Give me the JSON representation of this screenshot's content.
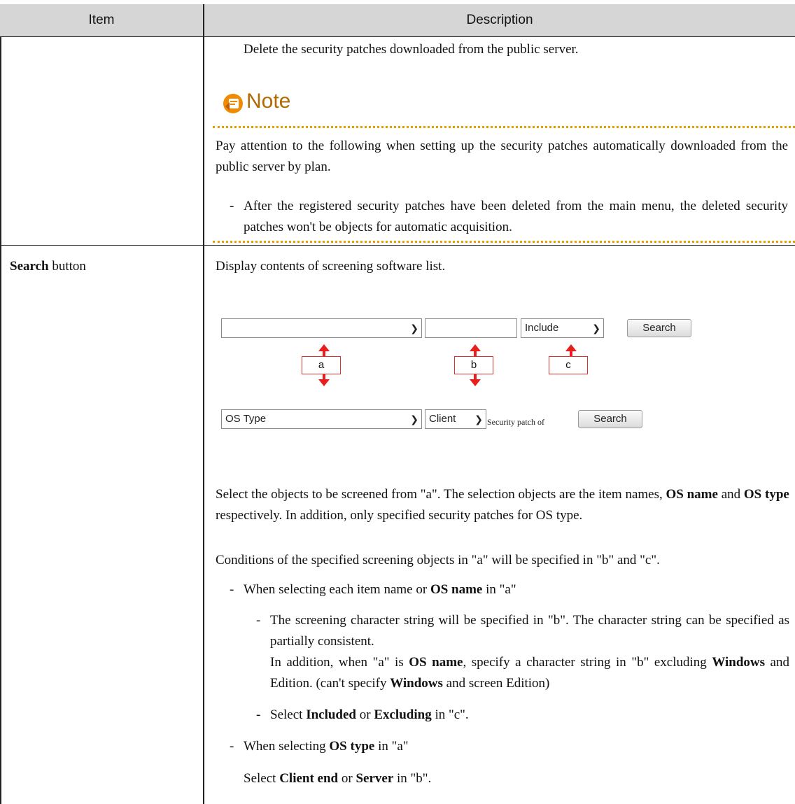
{
  "table": {
    "header": {
      "item": "Item",
      "description": "Description"
    },
    "row1": {
      "description_line": "Delete the security patches downloaded from the public server.",
      "note": {
        "title": "Note",
        "text": "Pay attention to the following when setting up the security patches automatically downloaded from the public server by plan.",
        "bullet": "After the registered security patches have been deleted from the main menu, the deleted security patches won't be objects for automatic acquisition."
      }
    },
    "row2": {
      "item_bold": "Search",
      "item_rest": "button",
      "intro": "Display contents of screening software list.",
      "mockup": {
        "top_select_a": "",
        "top_input_b": "",
        "top_select_c": "Include",
        "top_search": "Search",
        "label_a": "a",
        "label_b": "b",
        "label_c": "c",
        "bottom_select_a": "OS Type",
        "bottom_select_b": "Client",
        "bottom_text": "Security patch of",
        "bottom_search": "Search"
      },
      "p1_pre": "Select the objects to be screened from \"a\". The selection objects are the item names, ",
      "p1_b1": "OS name",
      "p1_mid": " and ",
      "p1_b2": "OS type",
      "p1_post": " respectively. In addition, only specified security patches for OS type.",
      "p2": "Conditions of the specified screening objects in \"a\" will be specified in \"b\" and \"c\".",
      "b1_pre": "When selecting each item name or ",
      "b1_bold": "OS name",
      "b1_post": " in \"a\"",
      "sb1_l1": "The screening character string will be specified in \"b\". The character string can be specified as partially consistent.",
      "sb1_l2_pre": "In addition, when \"a\" is ",
      "sb1_l2_b": "OS name",
      "sb1_l2_post": ", specify a character string in \"b\" excluding ",
      "sb1_l3_b1": "Windows",
      "sb1_l3_mid": " and Edition. (can't specify ",
      "sb1_l3_b2": "Windows",
      "sb1_l3_post": " and screen Edition)",
      "sb2_pre": "Select ",
      "sb2_b1": "Included",
      "sb2_mid": " or ",
      "sb2_b2": "Excluding",
      "sb2_post": " in \"c\".",
      "b2_pre": "When selecting ",
      "b2_bold": "OS type",
      "b2_post": " in \"a\"",
      "last_pre": "Select ",
      "last_b1": "Client end",
      "last_mid": " or ",
      "last_b2": "Server",
      "last_post": " in \"b\"."
    }
  }
}
